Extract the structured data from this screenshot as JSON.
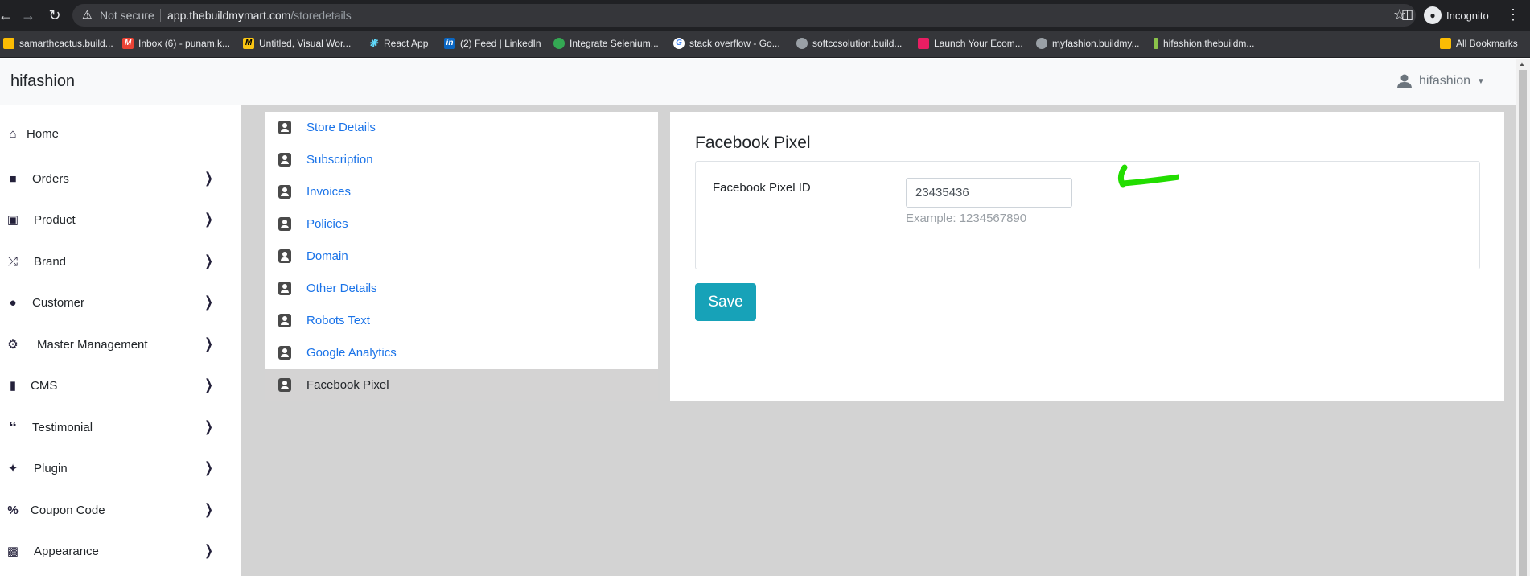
{
  "browser": {
    "security_text": "Not secure",
    "url_host": "app.thebuildmymart.com",
    "url_path": "/storedetails",
    "incognito_label": "Incognito",
    "bookmarks": [
      {
        "label": "samarthcactus.build...",
        "color": "#fbbc04"
      },
      {
        "label": "Inbox (6) - punam.k...",
        "color": "#ea4335"
      },
      {
        "label": "Untitled, Visual Wor...",
        "color": "#f9c513"
      },
      {
        "label": "React App",
        "color": "#61dafb"
      },
      {
        "label": "(2) Feed | LinkedIn",
        "color": "#0a66c2"
      },
      {
        "label": "Integrate Selenium...",
        "color": "#34a853"
      },
      {
        "label": "stack overflow - Go...",
        "color": "#4285f4"
      },
      {
        "label": "softccsolution.build...",
        "color": "#9aa0a6"
      },
      {
        "label": "Launch Your Ecom...",
        "color": "#e91e63"
      },
      {
        "label": "myfashion.buildmy...",
        "color": "#9aa0a6"
      },
      {
        "label": "hifashion.thebuildm...",
        "color": "#8bc34a"
      }
    ],
    "all_bookmarks": "All Bookmarks"
  },
  "header": {
    "brand": "hifashion",
    "user": "hifashion"
  },
  "sidebar": {
    "items": [
      {
        "label": "Home",
        "icon": "home-icon"
      },
      {
        "label": "Orders",
        "icon": "bag-icon"
      },
      {
        "label": "Product",
        "icon": "box-icon"
      },
      {
        "label": "Brand",
        "icon": "shuffle-icon"
      },
      {
        "label": "Customer",
        "icon": "user-icon"
      },
      {
        "label": "Master Management",
        "icon": "user-cog-icon"
      },
      {
        "label": "CMS",
        "icon": "file-icon"
      },
      {
        "label": "Testimonial",
        "icon": "quote-icon"
      },
      {
        "label": "Plugin",
        "icon": "puzzle-icon"
      },
      {
        "label": "Coupon Code",
        "icon": "percent-icon"
      },
      {
        "label": "Appearance",
        "icon": "image-icon"
      }
    ]
  },
  "settings": {
    "items": [
      "Store Details",
      "Subscription",
      "Invoices",
      "Policies",
      "Domain",
      "Other Details",
      "Robots Text",
      "Google Analytics",
      "Facebook Pixel"
    ],
    "active": "Facebook Pixel"
  },
  "panel": {
    "title": "Facebook Pixel",
    "field_label": "Facebook Pixel ID",
    "field_value": "23435436",
    "field_help": "Example: 1234567890",
    "save_label": "Save"
  },
  "colors": {
    "accent": "#17a2b8",
    "link": "#1a73e8",
    "annotation": "#22dd00"
  }
}
